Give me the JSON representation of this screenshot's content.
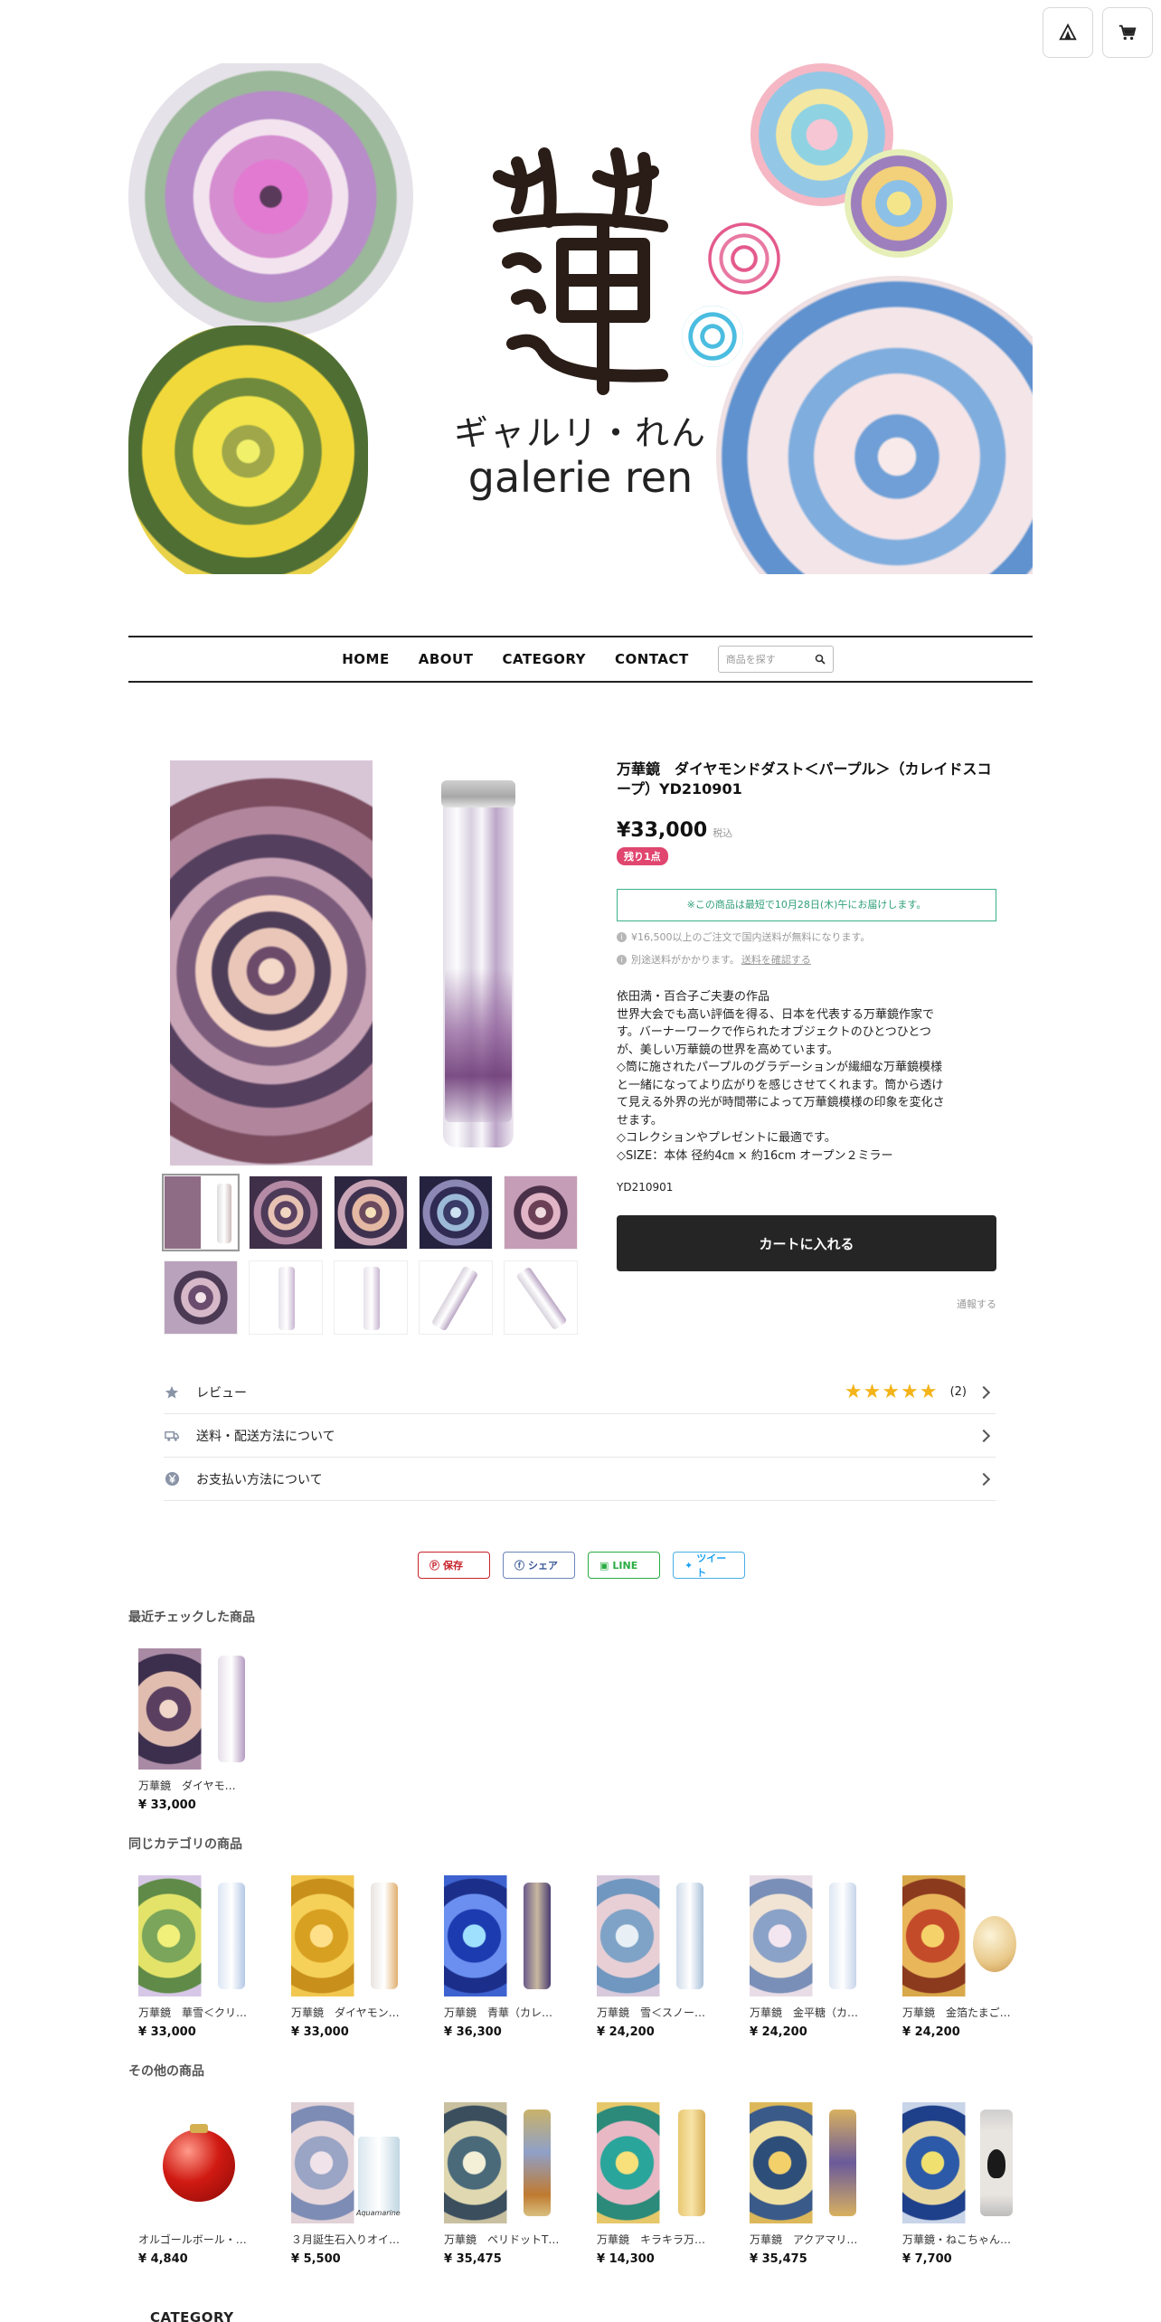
{
  "header": {
    "logo_ja": "ギャルリ・れん",
    "logo_en": "galerie ren"
  },
  "icons": {
    "tent": "tent-icon",
    "cart": "cart-icon",
    "search": "search-icon"
  },
  "nav": {
    "items": [
      "HOME",
      "ABOUT",
      "CATEGORY",
      "CONTACT"
    ],
    "search_placeholder": "商品を探す"
  },
  "product": {
    "title": "万華鏡　ダイヤモンドダスト＜パープル＞（カレイドスコープ）YD210901",
    "price": "¥33,000",
    "tax_label": "税込",
    "stock_badge": "残り1点",
    "delivery_notice": "※この商品は最短で10月28日(木)午にお届けします。",
    "free_shipping_note": "¥16,500以上のご注文で国内送料が無料になります。",
    "shipping_note": "別途送料がかかります。",
    "shipping_link": "送料を確認する",
    "description": [
      "依田満・百合子ご夫妻の作品",
      "世界大会でも高い評価を得る、日本を代表する万華鏡作家で",
      "す。バーナーワークで作られたオブジェクトのひとつひとつ",
      "が、美しい万華鏡の世界を高めています。",
      "◇筒に施されたパープルのグラデーションが繊細な万華鏡模様",
      "と一緒になってより広がりを感じさせてくれます。筒から透け",
      "て見える外界の光が時間帯によって万華鏡模様の印象を変化さ",
      "せます。",
      "◇コレクションやプレゼントに最適です。",
      "◇SIZE：本体 径約4㎝ × 約16cm オープン２ミラー"
    ],
    "sku": "YD210901",
    "cart_button": "カートに入れる",
    "report_link": "通報する",
    "rating": 5,
    "review_count": "(2)"
  },
  "accordion": {
    "review": "レビュー",
    "shipping": "送料・配送方法について",
    "payment": "お支払い方法について"
  },
  "share": {
    "pin": "保存",
    "facebook": "シェア",
    "line": "LINE",
    "tweet": "ツイート"
  },
  "recent": {
    "title": "最近チェックした商品",
    "items": [
      {
        "name": "万華鏡　ダイヤモ…",
        "price": "¥ 33,000"
      }
    ]
  },
  "same_category": {
    "title": "同じカテゴリの商品",
    "items": [
      {
        "name": "万華鏡　華雪＜クリ…",
        "price": "¥ 33,000"
      },
      {
        "name": "万華鏡　ダイヤモン…",
        "price": "¥ 33,000"
      },
      {
        "name": "万華鏡　青華（カレ…",
        "price": "¥ 36,300"
      },
      {
        "name": "万華鏡　雪＜スノー…",
        "price": "¥ 24,200"
      },
      {
        "name": "万華鏡　金平糖（カ…",
        "price": "¥ 24,200"
      },
      {
        "name": "万華鏡　金箔たまご…",
        "price": "¥ 24,200"
      }
    ]
  },
  "other": {
    "title": "その他の商品",
    "items": [
      {
        "name": "オルゴールボール・…",
        "price": "¥ 4,840"
      },
      {
        "name": "３月誕生石入りオイ…",
        "price": "¥ 5,500"
      },
      {
        "name": "万華鏡　ペリドットT…",
        "price": "¥ 35,475"
      },
      {
        "name": "万華鏡　キラキラ万…",
        "price": "¥ 14,300"
      },
      {
        "name": "万華鏡　アクアマリ…",
        "price": "¥ 35,475"
      },
      {
        "name": "万華鏡・ねこちゃん…",
        "price": "¥ 7,700"
      }
    ],
    "aquamarine_caption": "Aquamarine"
  },
  "footer": {
    "category_heading": "CATEGORY"
  }
}
